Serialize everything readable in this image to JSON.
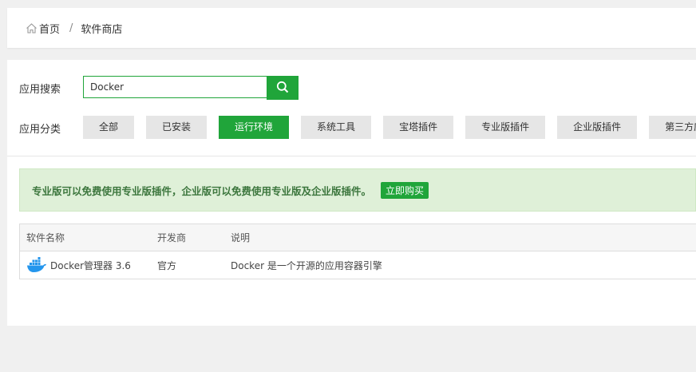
{
  "breadcrumb": {
    "home": "首页",
    "separator": "/",
    "current": "软件商店"
  },
  "search": {
    "label": "应用搜索",
    "value": "Docker"
  },
  "categories": {
    "label": "应用分类",
    "items": [
      {
        "label": "全部"
      },
      {
        "label": "已安装"
      },
      {
        "label": "运行环境",
        "active": true
      },
      {
        "label": "系统工具"
      },
      {
        "label": "宝塔插件"
      },
      {
        "label": "专业版插件"
      },
      {
        "label": "企业版插件"
      },
      {
        "label": "第三方应"
      }
    ]
  },
  "notice": {
    "text": "专业版可以免费使用专业版插件，企业版可以免费使用专业版及企业版插件。",
    "button": "立即购买"
  },
  "table": {
    "headers": [
      "软件名称",
      "开发商",
      "说明"
    ],
    "rows": [
      {
        "name": "Docker管理器 3.6",
        "developer": "官方",
        "description": "Docker 是一个开源的应用容器引擎",
        "icon": "docker-icon"
      }
    ]
  },
  "colors": {
    "accent": "#20a53a",
    "notice_bg": "#dff0d8",
    "notice_text": "#3c763d"
  }
}
